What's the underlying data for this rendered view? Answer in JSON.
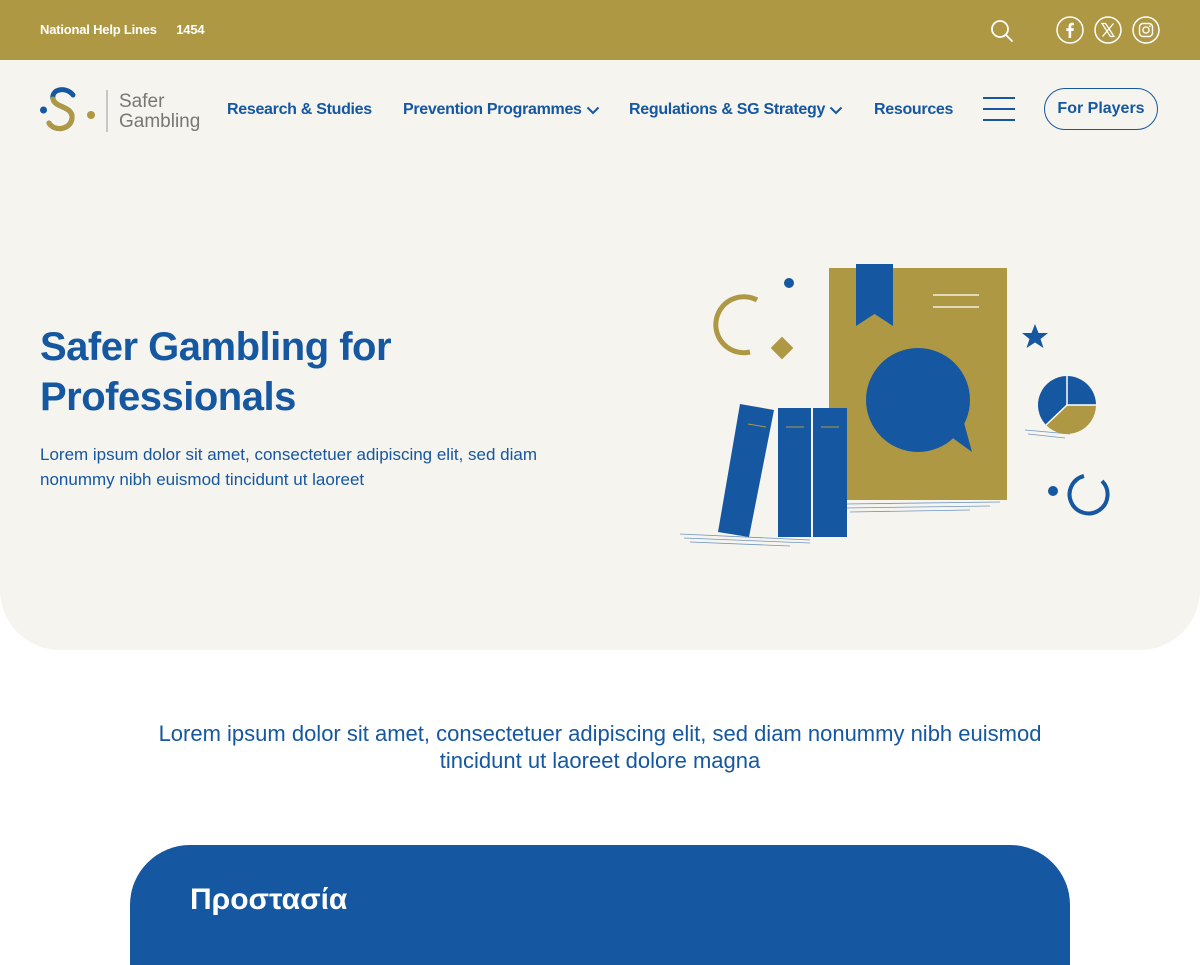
{
  "topbar": {
    "helpline_label": "National Help Lines",
    "helpline_number": "1454",
    "background": "#af9844",
    "icons": [
      "search-icon",
      "facebook-icon",
      "x-twitter-icon",
      "instagram-icon"
    ]
  },
  "logo": {
    "line1": "Safer",
    "line2": "Gambling"
  },
  "nav": {
    "items": [
      {
        "label": "Research & Studies",
        "dropdown": false
      },
      {
        "label": "Prevention Programmes",
        "dropdown": true
      },
      {
        "label": "Regulations & SG Strategy",
        "dropdown": true
      },
      {
        "label": "Resources",
        "dropdown": false
      }
    ],
    "cta_label": "For Players"
  },
  "hero": {
    "title": "Safer Gambling for Professionals",
    "subtitle": "Lorem ipsum dolor sit amet, consectetuer adipiscing elit, sed diam nonummy nibh euismod tincidunt ut laoreet"
  },
  "intro": {
    "text": "Lorem ipsum dolor sit amet, consectetuer adipiscing elit, sed diam nonummy nibh euismod tincidunt ut laoreet dolore magna"
  },
  "card": {
    "title": "Προστασία"
  },
  "colors": {
    "primary": "#1557a0",
    "accent": "#af9844",
    "hero_bg": "#f6f4ee"
  }
}
